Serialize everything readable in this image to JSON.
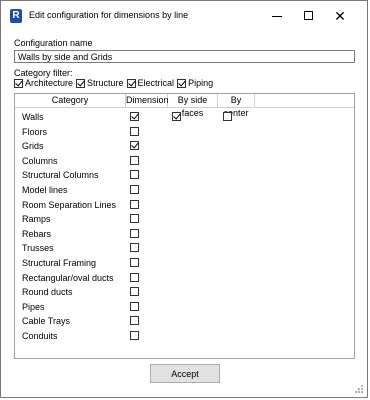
{
  "window": {
    "title": "Edit configuration for dimensions by line",
    "app_icon_letter": "R",
    "close_glyph": "✕"
  },
  "config_name": {
    "label": "Configuration name",
    "value": "Walls by side and Grids"
  },
  "category_filter": {
    "label": "Category filter:",
    "items": [
      {
        "label": "Architecture",
        "checked": true
      },
      {
        "label": "Structure",
        "checked": true
      },
      {
        "label": "Electrical",
        "checked": true
      },
      {
        "label": "Piping",
        "checked": true
      }
    ]
  },
  "grid": {
    "columns": [
      "Category",
      "Dimension",
      "By side faces",
      "By center"
    ],
    "rows": [
      {
        "category": "Walls",
        "dimension": true,
        "by_side_faces": true,
        "by_center": false,
        "show_options": true
      },
      {
        "category": "Floors",
        "dimension": false
      },
      {
        "category": "Grids",
        "dimension": true
      },
      {
        "category": "Columns",
        "dimension": false
      },
      {
        "category": "Structural Columns",
        "dimension": false
      },
      {
        "category": "Model lines",
        "dimension": false
      },
      {
        "category": "Room Separation Lines",
        "dimension": false
      },
      {
        "category": "Ramps",
        "dimension": false
      },
      {
        "category": "Rebars",
        "dimension": false
      },
      {
        "category": "Trusses",
        "dimension": false
      },
      {
        "category": "Structural Framing",
        "dimension": false
      },
      {
        "category": "Rectangular/oval ducts",
        "dimension": false
      },
      {
        "category": "Round ducts",
        "dimension": false
      },
      {
        "category": "Pipes",
        "dimension": false
      },
      {
        "category": "Cable Trays",
        "dimension": false
      },
      {
        "category": "Conduits",
        "dimension": false
      }
    ]
  },
  "accept_label": "Accept"
}
